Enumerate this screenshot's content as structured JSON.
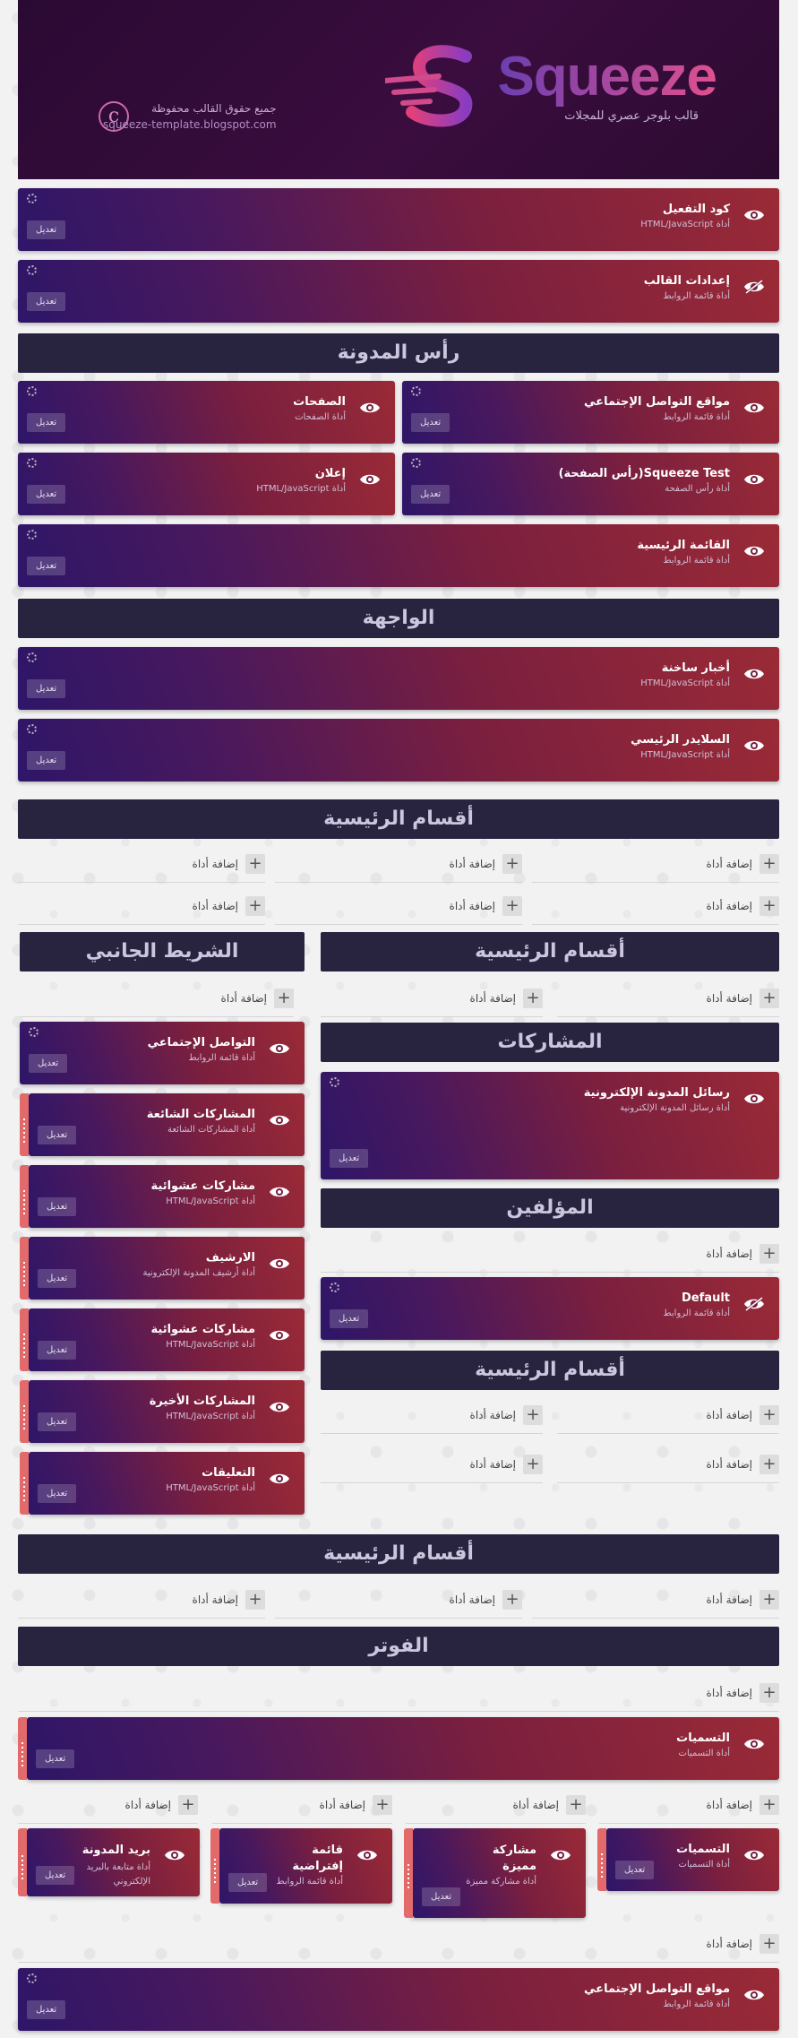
{
  "header": {
    "brand": "Squeeze",
    "tagline": "قالب بلوجر عصري للمجلات",
    "copyright": "جميع حقوق القالب محفوظة",
    "site": "squeeze-template.blogspot.com",
    "mark": "c"
  },
  "common": {
    "edit": "تعديل",
    "add": "إضافة أداة"
  },
  "sections": {
    "header": "رأس المدونة",
    "front": "الواجهة",
    "main": "أقسام الرئيسية",
    "sidebar": "الشريط الجانبي",
    "posts": "المشاركات",
    "authors": "المؤلفين",
    "footer": "الفوتر"
  },
  "widgets": {
    "activation": {
      "title": "كود التفعيل",
      "sub": "أداة HTML/JavaScript"
    },
    "settings": {
      "title": "إعدادات القالب",
      "sub": "أداة قائمة الروابط"
    },
    "social": {
      "title": "مواقع التواصل الإجتماعي",
      "sub": "أداة قائمة الروابط"
    },
    "pages": {
      "title": "الصفحات",
      "sub": "أداة الصفحات"
    },
    "squeeze": {
      "title": "Squeeze Test(رأس الصفحة)",
      "sub": "أداة رأس الصفحة"
    },
    "ad": {
      "title": "إعلان",
      "sub": "أداة HTML/JavaScript"
    },
    "mainmenu": {
      "title": "القائمة الرئيسية",
      "sub": "أداة قائمة الروابط"
    },
    "breaking": {
      "title": "أخبار ساخنة",
      "sub": "أداة HTML/JavaScript"
    },
    "slider": {
      "title": "السلايدر الرئيسي",
      "sub": "أداة HTML/JavaScript"
    },
    "blogposts": {
      "title": "رسائل المدونة الإلكترونية",
      "sub": "أداة رسائل المدونة الإلكترونية"
    },
    "default": {
      "title": "Default",
      "sub": "أداة قائمة الروابط"
    },
    "sb_social": {
      "title": "التواصل الإجتماعي",
      "sub": "أداة قائمة الروابط"
    },
    "popular": {
      "title": "المشاركات الشائعة",
      "sub": "أداة المشاركات الشائعة"
    },
    "random1": {
      "title": "مشاركات عشوائية",
      "sub": "أداة HTML/JavaScript"
    },
    "archive": {
      "title": "الارشيف",
      "sub": "أداة أرشيف المدونة الإلكترونية"
    },
    "random2": {
      "title": "مشاركات عشوائية",
      "sub": "أداة HTML/JavaScript"
    },
    "recent": {
      "title": "المشاركات الأخيرة",
      "sub": "أداة HTML/JavaScript"
    },
    "comments": {
      "title": "التعليقات",
      "sub": "أداة HTML/JavaScript"
    },
    "labels": {
      "title": "التسميات",
      "sub": "أداة التسميات"
    },
    "f_labels": {
      "title": "التسميات",
      "sub": "أداة التسميات"
    },
    "f_featured": {
      "title": "مشاركة مميزة",
      "sub": "أداة مشاركة مميزة"
    },
    "f_default": {
      "title": "قائمة إفتراضية",
      "sub": "أداة قائمة الروابط"
    },
    "f_email": {
      "title": "بريد المدونة",
      "sub": "أداة متابعة بالبريد الإلكتروني"
    },
    "f_social": {
      "title": "مواقع التواصل الإجتماعي",
      "sub": "أداة قائمة الروابط"
    }
  }
}
